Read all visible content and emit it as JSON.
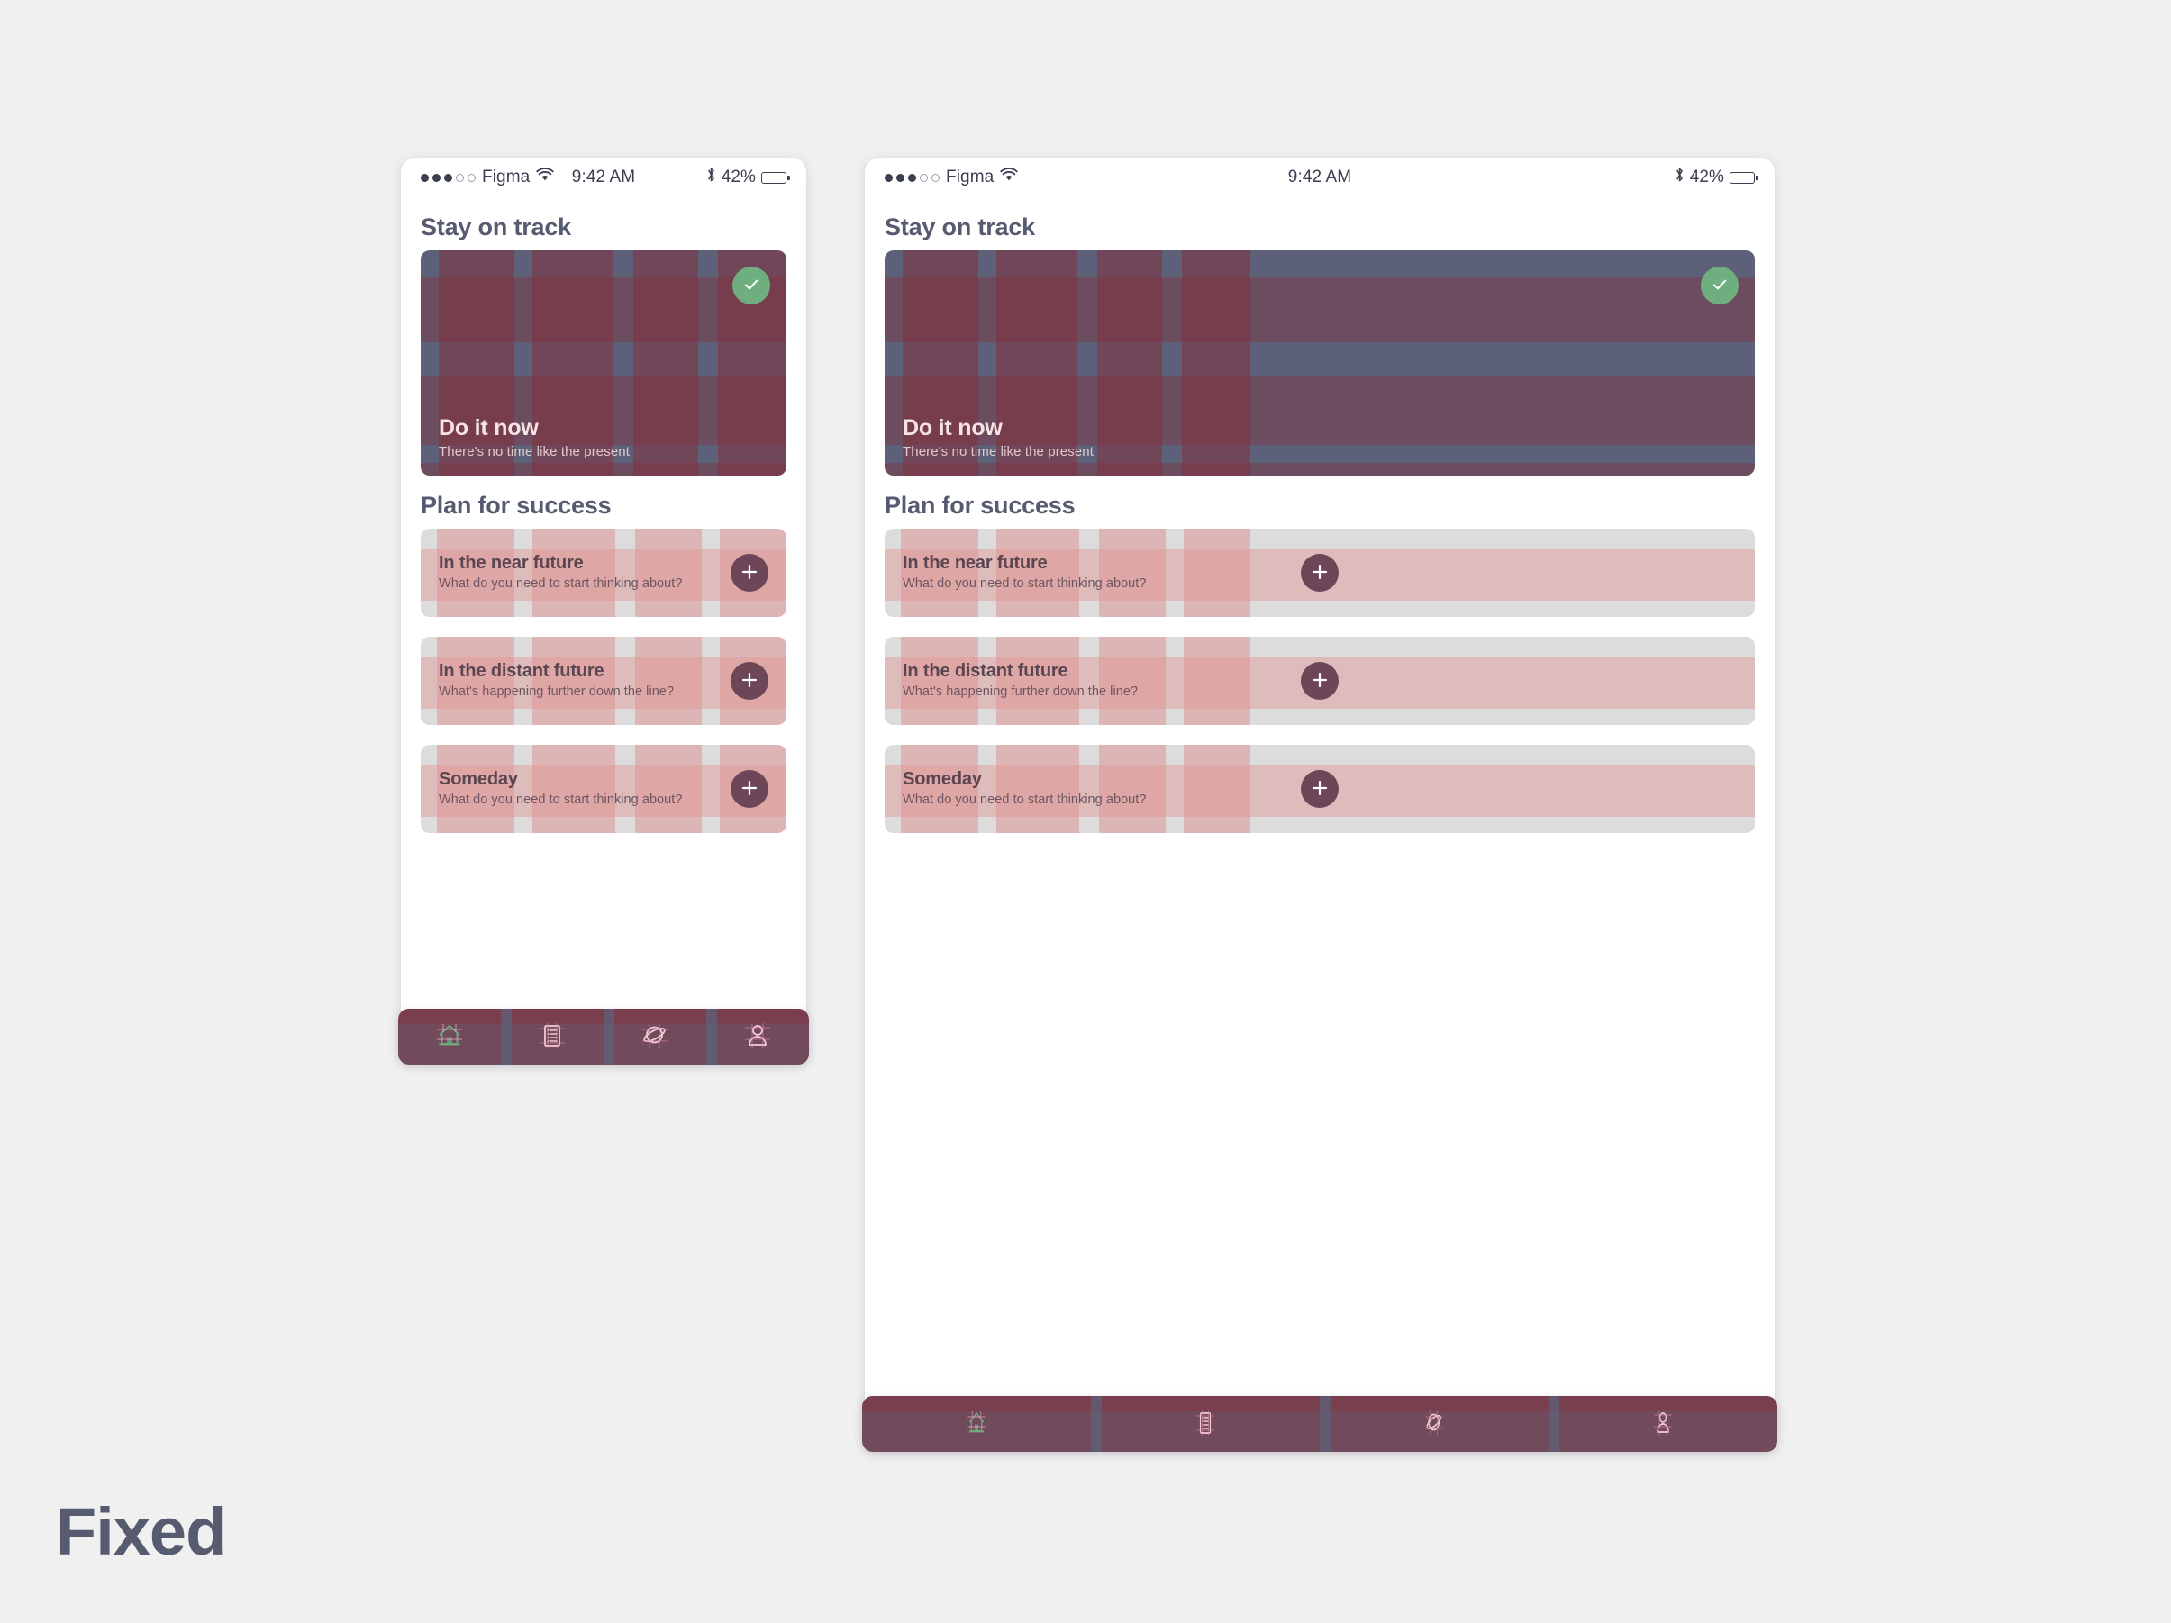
{
  "canvas": {
    "background_color": "#f0f0f0",
    "caption": "Fixed"
  },
  "status_bar": {
    "carrier": "Figma",
    "signal_dots_filled": 3,
    "signal_dots_total": 5,
    "wifi_icon": "wifi-icon",
    "time": "9:42 AM",
    "bluetooth_icon": "bluetooth-icon",
    "battery_percent": "42%",
    "battery_level": 42
  },
  "screen": {
    "section_one_title": "Stay on track",
    "section_two_title": "Plan for success",
    "hero": {
      "title": "Do it now",
      "subtitle": "There's no time like the present",
      "check_icon": "check-icon",
      "check_color": "#6fae7f",
      "base_color": "#5c6179",
      "band_color": "#84313e"
    },
    "cards": [
      {
        "title": "In the near future",
        "subtitle": "What do you need to start thinking about?",
        "add_icon": "plus-icon"
      },
      {
        "title": "In the distant future",
        "subtitle": "What's happening further down the line?",
        "add_icon": "plus-icon"
      },
      {
        "title": "Someday",
        "subtitle": "What do you need to start thinking about?",
        "add_icon": "plus-icon"
      }
    ],
    "card_style": {
      "base_color": "#dcdcdc",
      "band_color": "#de9694",
      "button_color": "#6d4758"
    },
    "nav": {
      "background_color": "#714b5c",
      "items": [
        {
          "icon": "home-icon",
          "active": true
        },
        {
          "icon": "list-icon",
          "active": false
        },
        {
          "icon": "planet-icon",
          "active": false
        },
        {
          "icon": "person-icon",
          "active": false
        }
      ],
      "active_color": "#6fae7f",
      "inactive_color": "#f0c4cb"
    }
  },
  "frames": [
    {
      "name": "narrow",
      "width_label": "450",
      "height_label": "1000"
    },
    {
      "name": "wide",
      "width_label": "1010",
      "height_label": "1430"
    }
  ]
}
